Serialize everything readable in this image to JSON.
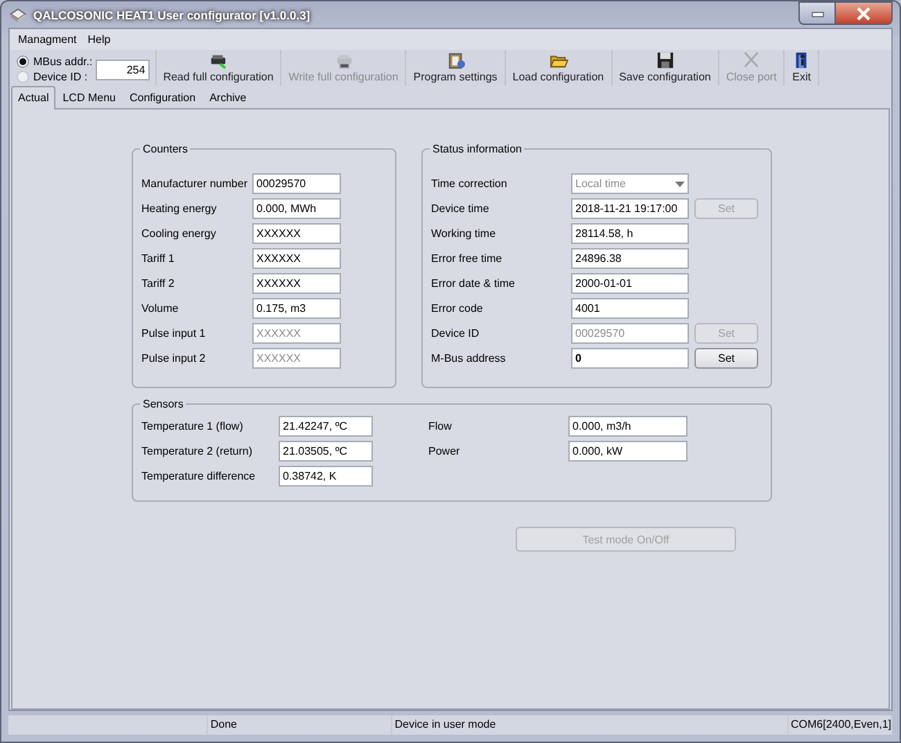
{
  "window": {
    "title": "QALCOSONIC HEAT1 User configurator [v1.0.0.3]"
  },
  "menu": [
    "Managment",
    "Help"
  ],
  "address": {
    "modes": [
      {
        "label": "MBus addr.:",
        "selected": true
      },
      {
        "label": "Device ID  :",
        "selected": false
      }
    ],
    "value": "254"
  },
  "toolbar": [
    {
      "label": "Read full configuration",
      "disabled": false
    },
    {
      "label": "Write full configuration",
      "disabled": true
    },
    {
      "label": "Program settings",
      "disabled": false
    },
    {
      "label": "Load configuration",
      "disabled": false
    },
    {
      "label": "Save configuration",
      "disabled": false
    },
    {
      "label": "Close port",
      "disabled": true
    },
    {
      "label": "Exit",
      "disabled": false
    }
  ],
  "tabs": [
    {
      "label": "Actual",
      "selected": true
    },
    {
      "label": "LCD Menu",
      "selected": false
    },
    {
      "label": "Configuration",
      "selected": false
    },
    {
      "label": "Archive",
      "selected": false
    }
  ],
  "counters": {
    "title": "Counters",
    "rows": [
      {
        "label": "Manufacturer number",
        "value": "00029570",
        "disabled": false
      },
      {
        "label": "Heating energy",
        "value": "0.000, MWh",
        "disabled": false
      },
      {
        "label": "Cooling energy",
        "value": "XXXXXX",
        "disabled": false
      },
      {
        "label": "Tariff 1",
        "value": "XXXXXX",
        "disabled": false
      },
      {
        "label": "Tariff 2",
        "value": "XXXXXX",
        "disabled": false
      },
      {
        "label": "Volume",
        "value": "0.175, m3",
        "disabled": false
      },
      {
        "label": "Pulse input 1",
        "value": "XXXXXX",
        "disabled": true
      },
      {
        "label": "Pulse input 2",
        "value": "XXXXXX",
        "disabled": true
      }
    ]
  },
  "status": {
    "title": "Status information",
    "rows": [
      {
        "kind": "dropdown",
        "label": "Time correction",
        "value": "Local time",
        "disabled": true
      },
      {
        "kind": "field",
        "label": "Device time",
        "value": "2018-11-21 19:17:00",
        "disabled": false,
        "bold": false,
        "button": {
          "label": "Set",
          "disabled": true
        }
      },
      {
        "kind": "field",
        "label": "Working time",
        "value": "28114.58, h",
        "disabled": false,
        "bold": false
      },
      {
        "kind": "field",
        "label": "Error free time",
        "value": "24896.38",
        "disabled": false,
        "bold": false
      },
      {
        "kind": "field",
        "label": "Error date & time",
        "value": "2000-01-01",
        "disabled": false,
        "bold": false
      },
      {
        "kind": "field",
        "label": "Error code",
        "value": "4001",
        "disabled": false,
        "bold": false
      },
      {
        "kind": "field",
        "label": "Device ID",
        "value": "00029570",
        "disabled": true,
        "bold": false,
        "button": {
          "label": "Set",
          "disabled": true
        }
      },
      {
        "kind": "field",
        "label": "M-Bus address",
        "value": "0",
        "disabled": false,
        "bold": true,
        "button": {
          "label": "Set",
          "disabled": false
        }
      }
    ]
  },
  "sensors": {
    "title": "Sensors",
    "columns": [
      [
        {
          "label": "Temperature 1 (flow)",
          "value": "21.42247, ºC"
        },
        {
          "label": "Temperature 2 (return)",
          "value": "21.03505, ºC"
        },
        {
          "label": "Temperature difference",
          "value": "0.38742, K"
        }
      ],
      [
        {
          "label": "Flow",
          "value": "0.000, m3/h"
        },
        {
          "label": "Power",
          "value": "0.000, kW"
        }
      ]
    ]
  },
  "test_button": {
    "label": "Test mode On/Off",
    "disabled": true
  },
  "status_bar": [
    "Done",
    "Device in user mode",
    "COM6[2400,Even,1]"
  ]
}
